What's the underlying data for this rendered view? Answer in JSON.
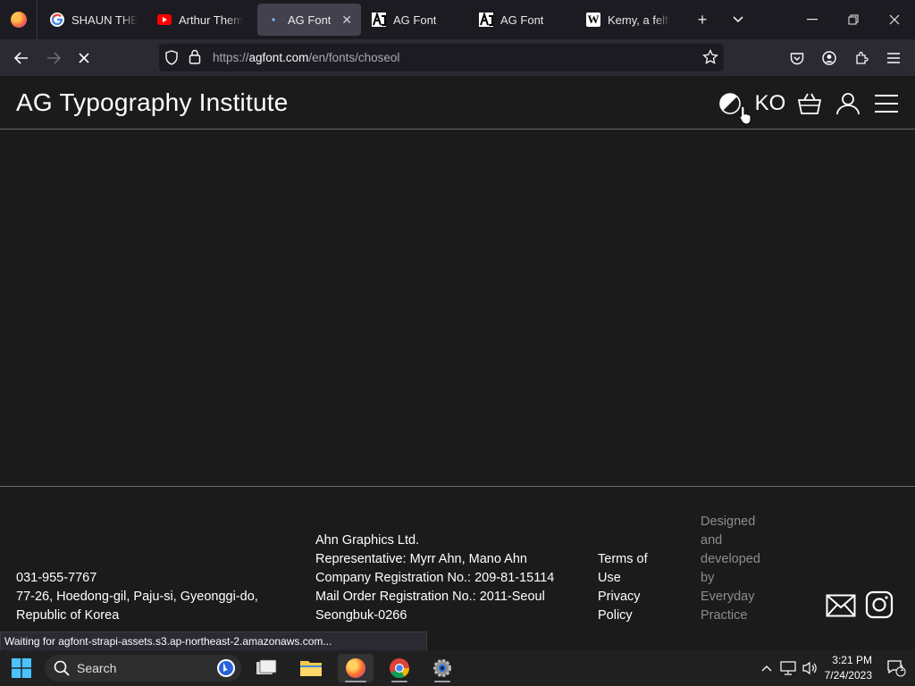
{
  "browser": {
    "tabs": [
      {
        "title": "SHAUN THE SHEEP",
        "favicon": "google-icon"
      },
      {
        "title": "Arthur Theme",
        "favicon": "youtube-icon"
      },
      {
        "title": "AG Font",
        "favicon": "loading-icon",
        "active": true
      },
      {
        "title": "AG Font",
        "favicon": "ag-icon"
      },
      {
        "title": "AG Font",
        "favicon": "ag-icon"
      },
      {
        "title": "Kemy, a felfedező",
        "favicon": "wikipedia-icon"
      }
    ],
    "url": {
      "prefix": "https://",
      "host": "agfont.com",
      "path": "/en/fonts/choseol"
    },
    "status_text": "Waiting for agfont-strapi-assets.s3.ap-northeast-2.amazonaws.com..."
  },
  "site": {
    "title": "AG Typography Institute",
    "language_label": "KO"
  },
  "footer": {
    "contact": {
      "phone": "031-955-7767",
      "address_line1": "77-26, Hoedong-gil, Paju-si, Gyeonggi-do,",
      "address_line2": "Republic of Korea"
    },
    "company": {
      "name": "Ahn Graphics Ltd.",
      "representative": "Representative: Myrr Ahn, Mano Ahn",
      "registration": "Company Registration No.: 209-81-15114",
      "mail_order_line1": "Mail Order Registration No.: 2011-Seoul",
      "mail_order_line2": "Seongbuk-0266"
    },
    "links": {
      "terms_line1": "Terms of",
      "terms_line2": "Use",
      "privacy_line1": "Privacy",
      "privacy_line2": "Policy"
    },
    "credit": [
      "Designed",
      "and",
      "developed",
      "by",
      "Everyday",
      "Practice"
    ]
  },
  "taskbar": {
    "search_placeholder": "Search",
    "time": "3:21 PM",
    "date": "7/24/2023",
    "notification_count": "1"
  },
  "colors": {
    "page_bg": "#1c1b1c",
    "browser_chrome": "#2b2a33",
    "tabstrip": "#1c1b22",
    "muted_text": "#8d8d8d"
  }
}
